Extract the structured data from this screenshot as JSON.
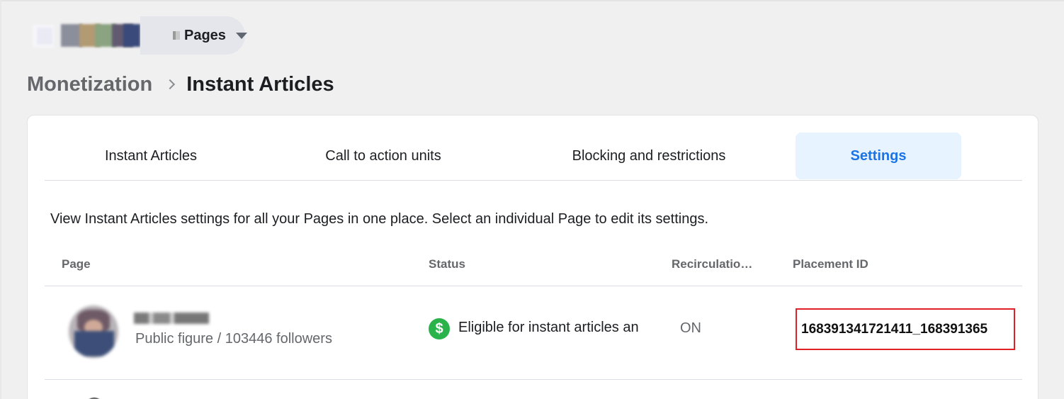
{
  "account_switcher": {
    "label": "Pages",
    "icon": "chevron-down-icon"
  },
  "breadcrumb": {
    "parent": "Monetization",
    "current": "Instant Articles"
  },
  "tabs": [
    {
      "label": "Instant Articles",
      "active": false
    },
    {
      "label": "Call to action units",
      "active": false
    },
    {
      "label": "Blocking and restrictions",
      "active": false
    },
    {
      "label": "Settings",
      "active": true
    }
  ],
  "intro_text": "View Instant Articles settings for all your Pages in one place. Select an individual Page to edit its settings.",
  "table": {
    "columns": [
      "Page",
      "Status",
      "Recirculation…",
      "Placement ID"
    ],
    "rows": [
      {
        "page_meta": "Public figure / 103446 followers",
        "status_icon": "dollar-circle-icon",
        "status": "Eligible for instant articles and",
        "recirculation": "ON",
        "placement_id": "168391341721411_168391365"
      }
    ]
  },
  "colors": {
    "background": "#f0f0f0",
    "accent": "#1b74e4",
    "active_tab_bg": "#e7f3ff",
    "status_green": "#2ab24b",
    "highlight_red": "#e01f26"
  }
}
